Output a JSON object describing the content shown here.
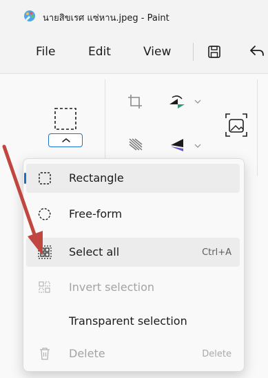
{
  "window": {
    "title": "นายสิขเรศ แซ่หาน.jpeg - Paint"
  },
  "menubar": {
    "file": "File",
    "edit": "Edit",
    "view": "View"
  },
  "select_dropdown": {
    "items": [
      {
        "label": "Rectangle",
        "icon": "rectangle-select-icon",
        "selected": true,
        "enabled": true,
        "shortcut": ""
      },
      {
        "label": "Free-form",
        "icon": "freeform-select-icon",
        "selected": false,
        "enabled": true,
        "shortcut": ""
      },
      {
        "label": "Select all",
        "icon": "select-all-icon",
        "selected": false,
        "enabled": true,
        "shortcut": "Ctrl+A"
      },
      {
        "label": "Invert selection",
        "icon": "invert-selection-icon",
        "selected": false,
        "enabled": false,
        "shortcut": ""
      },
      {
        "label": "Transparent selection",
        "icon": "",
        "selected": false,
        "enabled": true,
        "shortcut": ""
      },
      {
        "label": "Delete",
        "icon": "trash-icon",
        "selected": false,
        "enabled": false,
        "shortcut": "Delete"
      }
    ]
  },
  "colors": {
    "accent": "#1b6dc1",
    "annotation_arrow": "#c0463f"
  }
}
